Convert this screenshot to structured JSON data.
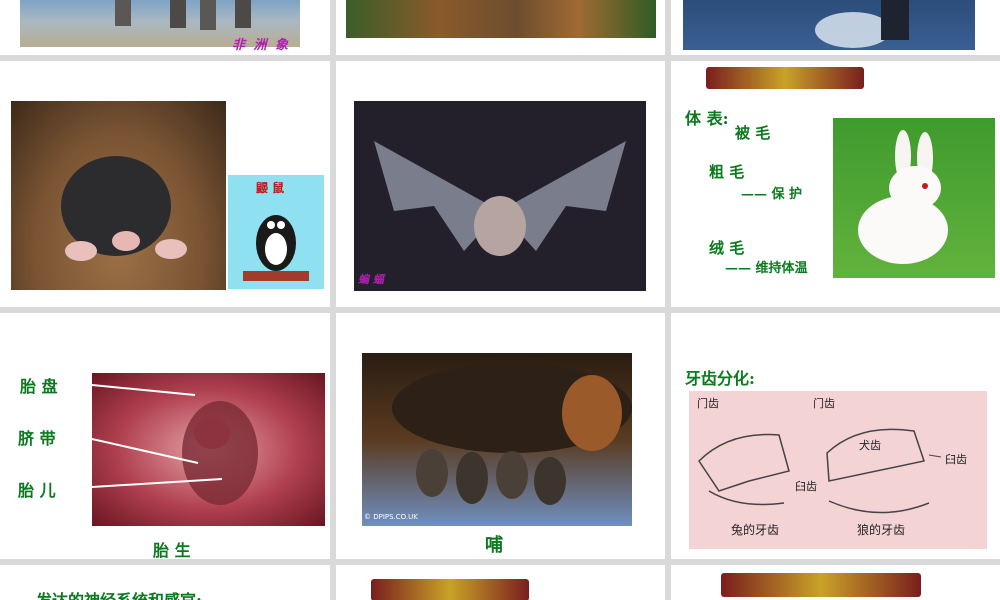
{
  "slides": {
    "s1_caption": "非 洲 象",
    "s4_mole_label": "鼹 鼠",
    "s5_bat_caption": "蝙 蝠",
    "s6": {
      "body_label": "体 表:",
      "fur": "被 毛",
      "coarse": "粗 毛",
      "protect": "—— 保 护",
      "fine": "绒 毛",
      "warm": "—— 维持体温"
    },
    "s7": {
      "placenta": "胎 盘",
      "cord": "脐 带",
      "fetus": "胎 儿",
      "caption": "胎 生"
    },
    "s8": {
      "caption": "哺",
      "watermark": "© DPIPS.CO.UK"
    },
    "s9": {
      "title": "牙齿分化:",
      "incisor_left": "门齿",
      "molar_left": "臼齿",
      "incisor_right": "门齿",
      "canine": "犬齿",
      "molar_right": "臼齿",
      "rabbit_caption": "兔的牙齿",
      "wolf_caption": "狼的牙齿"
    },
    "s10_text": "发达的神经系统和感官:"
  },
  "colors": {
    "green": "#0b7a1e",
    "purple": "#b01fb0",
    "gold": "#c9a227"
  }
}
